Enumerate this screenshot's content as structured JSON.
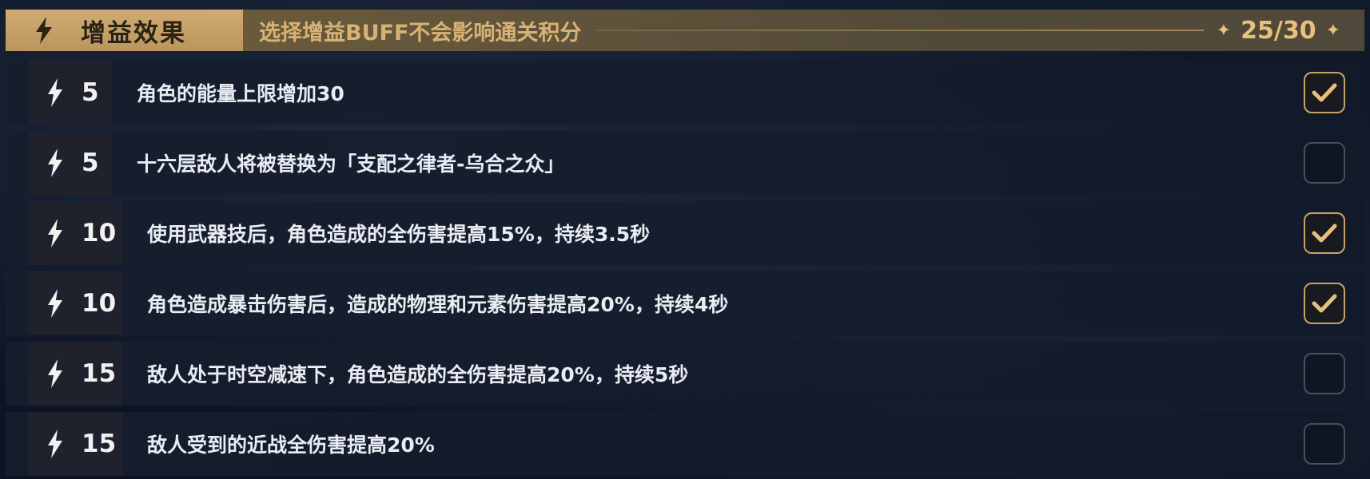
{
  "header": {
    "title": "增益效果",
    "subtitle": "选择增益BUFF不会影响通关积分",
    "count": "25/30",
    "icon": "lightning-icon",
    "sparkle_left": "✦",
    "sparkle_right": "✦"
  },
  "colors": {
    "accent_gold": "#c7a266",
    "header_gold": "#d0ac73",
    "background": "#0d1423"
  },
  "buffs": [
    {
      "cost": "5",
      "text": "角色的能量上限增加30",
      "checked": true
    },
    {
      "cost": "5",
      "text": "十六层敌人将被替换为「支配之律者-乌合之众」",
      "checked": false
    },
    {
      "cost": "10",
      "text": "使用武器技后，角色造成的全伤害提高15%，持续3.5秒",
      "checked": true
    },
    {
      "cost": "10",
      "text": "角色造成暴击伤害后，造成的物理和元素伤害提高20%，持续4秒",
      "checked": true
    },
    {
      "cost": "15",
      "text": "敌人处于时空减速下，角色造成的全伤害提高20%，持续5秒",
      "checked": false
    },
    {
      "cost": "15",
      "text": "敌人受到的近战全伤害提高20%",
      "checked": false
    }
  ]
}
